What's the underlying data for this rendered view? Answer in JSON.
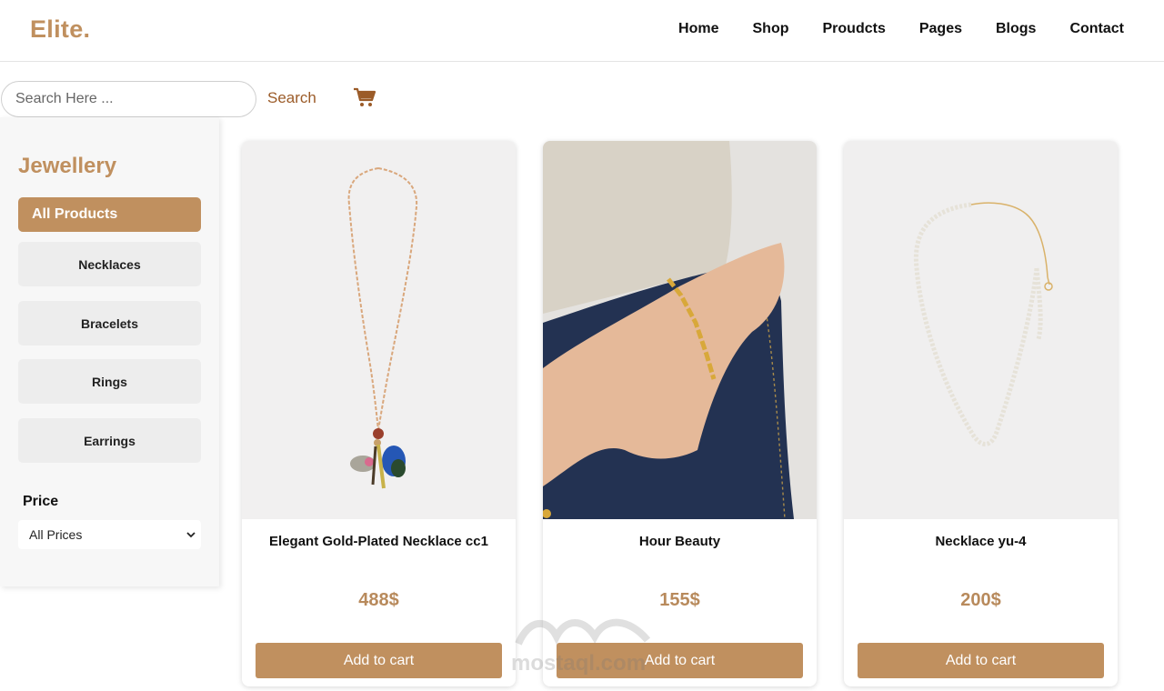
{
  "header": {
    "logo": "Elite.",
    "nav": [
      "Home",
      "Shop",
      "Proudcts",
      "Pages",
      "Blogs",
      "Contact"
    ]
  },
  "search": {
    "placeholder": "Search Here ...",
    "button_label": "Search",
    "cart_icon": "shopping-cart-icon"
  },
  "sidebar": {
    "title": "Jewellery",
    "categories": [
      "All Products",
      "Necklaces",
      "Bracelets",
      "Rings",
      "Earrings"
    ],
    "active_category": "All Products",
    "price_label": "Price",
    "price_selected": "All Prices"
  },
  "products": [
    {
      "name": "Elegant Gold-Plated Necklace cc1",
      "price": "488$",
      "button": "Add to cart"
    },
    {
      "name": "Hour Beauty",
      "price": "155$",
      "button": "Add to cart"
    },
    {
      "name": "Necklace yu-4",
      "price": "200$",
      "button": "Add to cart"
    }
  ],
  "watermark": "mostaql.com",
  "colors": {
    "accent": "#c0905f",
    "search_text": "#9b5b28",
    "price": "#b88a5c"
  }
}
